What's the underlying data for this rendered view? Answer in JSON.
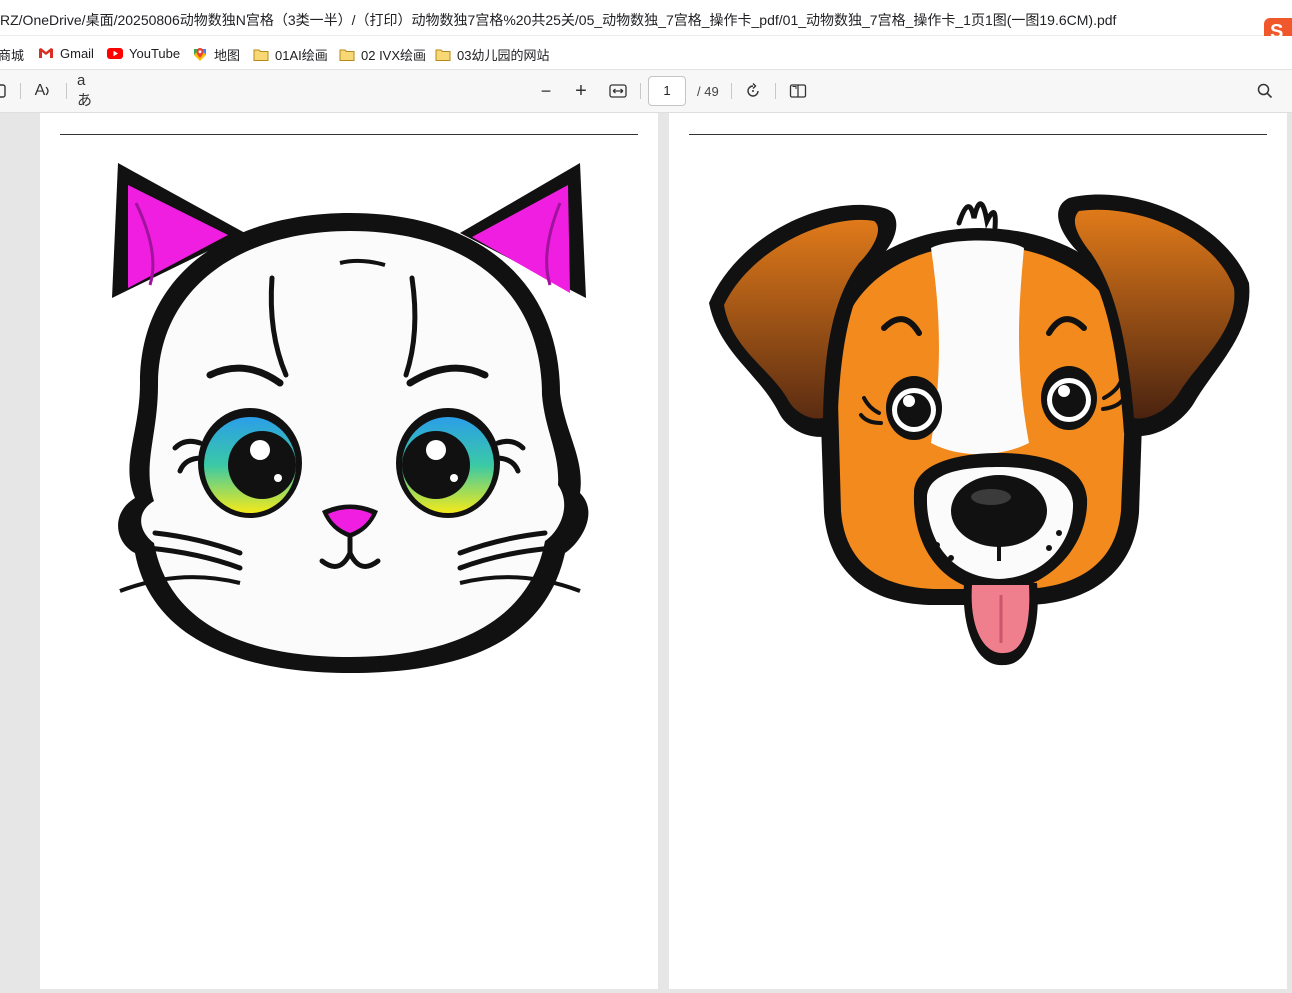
{
  "address_bar": {
    "url": "RZ/OneDrive/桌面/20250806动物数独N宫格（3类一半）/（打印）动物数独7宫格%20共25关/05_动物数独_7宫格_操作卡_pdf/01_动物数独_7宫格_操作卡_1页1图(一图19.6CM).pdf"
  },
  "bookmarks": [
    {
      "label": "商城",
      "icon": "shop-icon"
    },
    {
      "label": "Gmail",
      "icon": "gmail-icon"
    },
    {
      "label": "YouTube",
      "icon": "youtube-icon"
    },
    {
      "label": "地图",
      "icon": "maps-icon"
    },
    {
      "label": "01AI绘画",
      "icon": "folder-icon"
    },
    {
      "label": "02 IVX绘画",
      "icon": "folder-icon"
    },
    {
      "label": "03幼儿园的网站",
      "icon": "folder-icon"
    }
  ],
  "pdf_toolbar": {
    "read_aloud_label": "A",
    "translate_label": "aあ",
    "zoom_out_label": "−",
    "zoom_in_label": "+",
    "current_page": "1",
    "page_count": "/ 49"
  },
  "pages": [
    {
      "content": "cat-face-illustration"
    },
    {
      "content": "dog-face-illustration"
    }
  ],
  "colors": {
    "page_bg": "#ffffff",
    "viewer_bg": "#e6e6e6",
    "cat_ear": "#f01ee0",
    "dog_orange": "#f28a1d",
    "dog_brown": "#6b3516",
    "dog_tongue": "#f07f8e"
  }
}
